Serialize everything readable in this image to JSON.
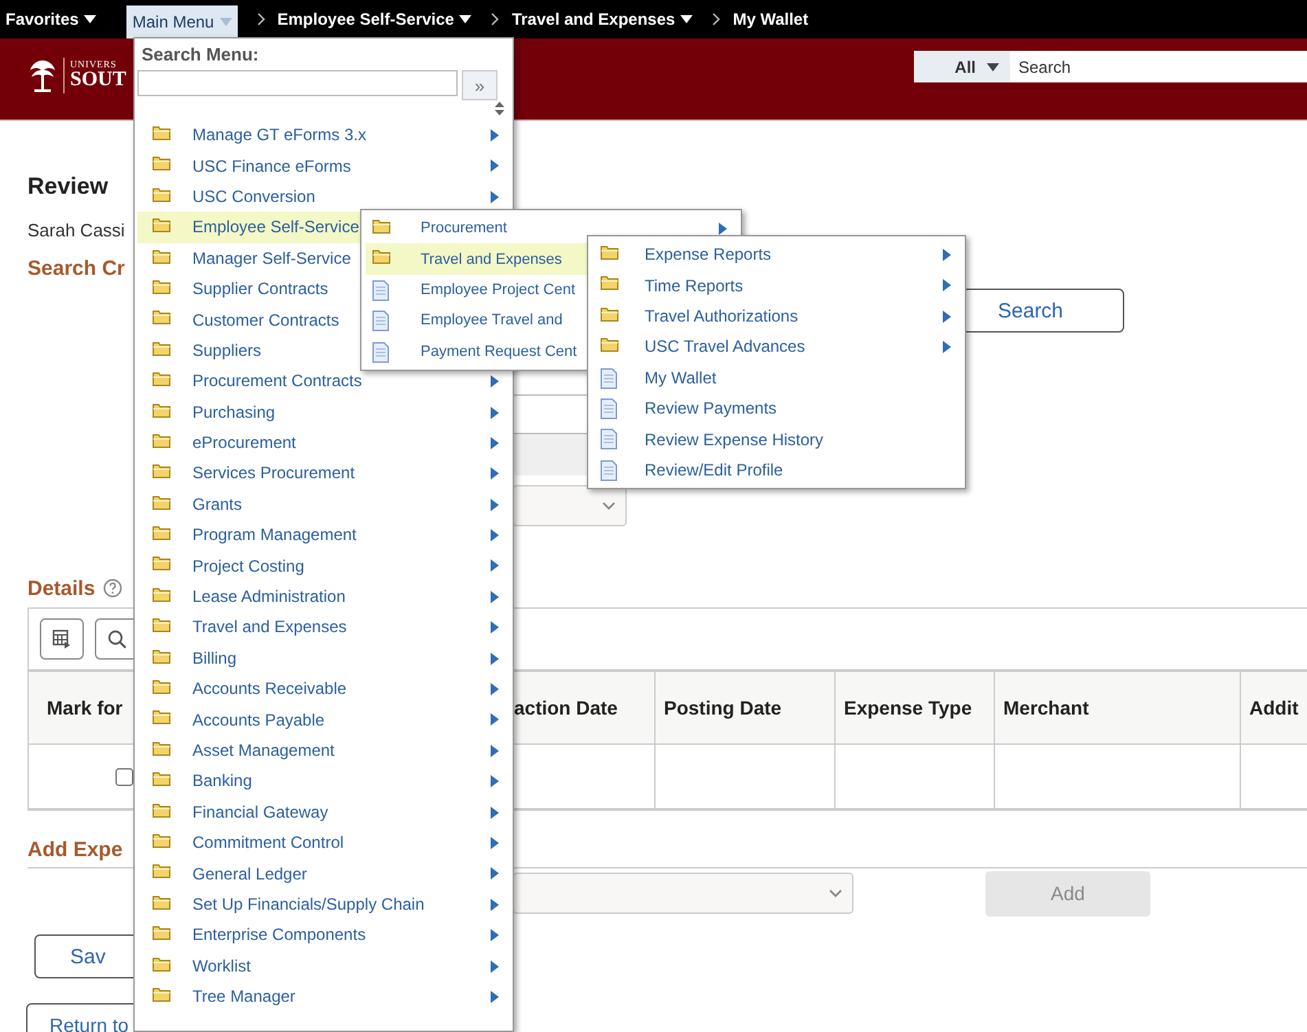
{
  "top_bar": {
    "favorites": "Favorites",
    "main_menu": {
      "label": "Main Menu",
      "selected": true
    },
    "breadcrumbs": [
      {
        "label": "Employee Self-Service",
        "dropdown": true
      },
      {
        "label": "Travel and Expenses",
        "dropdown": true
      },
      {
        "label": "My Wallet",
        "dropdown": false
      }
    ]
  },
  "header": {
    "logo_text": [
      "UNIVERS",
      "SOUT"
    ],
    "search_scope": "All",
    "search_placeholder": "Search"
  },
  "page": {
    "title": "Review",
    "user": "Sarah Cassi",
    "search_heading": "Search Cr",
    "search_button": "Search",
    "details_heading": "Details",
    "table": {
      "columns": [
        "Mark for",
        "action Date",
        "Posting Date",
        "Expense Type",
        "Merchant",
        "Addit"
      ],
      "rows": [
        {
          "checked": false
        }
      ]
    },
    "add_heading": "Add Expe",
    "add_button": {
      "label": "Add",
      "disabled": true
    },
    "save_button": "Sav",
    "return_button": "Return to"
  },
  "main_menu": {
    "title": "Search Menu:",
    "go_button": "»",
    "items": [
      {
        "label": "Manage GT eForms 3.x",
        "kind": "folder",
        "selected": false
      },
      {
        "label": "USC Finance eForms",
        "kind": "folder",
        "selected": false
      },
      {
        "label": "USC Conversion",
        "kind": "folder",
        "selected": false
      },
      {
        "label": "Employee Self-Service",
        "kind": "folder",
        "selected": true
      },
      {
        "label": "Manager Self-Service",
        "kind": "folder",
        "selected": false
      },
      {
        "label": "Supplier Contracts",
        "kind": "folder",
        "selected": false
      },
      {
        "label": "Customer Contracts",
        "kind": "folder",
        "selected": false
      },
      {
        "label": "Suppliers",
        "kind": "folder",
        "selected": false
      },
      {
        "label": "Procurement Contracts",
        "kind": "folder",
        "selected": false
      },
      {
        "label": "Purchasing",
        "kind": "folder",
        "selected": false
      },
      {
        "label": "eProcurement",
        "kind": "folder",
        "selected": false
      },
      {
        "label": "Services Procurement",
        "kind": "folder",
        "selected": false
      },
      {
        "label": "Grants",
        "kind": "folder",
        "selected": false
      },
      {
        "label": "Program Management",
        "kind": "folder",
        "selected": false
      },
      {
        "label": "Project Costing",
        "kind": "folder",
        "selected": false
      },
      {
        "label": "Lease Administration",
        "kind": "folder",
        "selected": false
      },
      {
        "label": "Travel and Expenses",
        "kind": "folder",
        "selected": false
      },
      {
        "label": "Billing",
        "kind": "folder",
        "selected": false
      },
      {
        "label": "Accounts Receivable",
        "kind": "folder",
        "selected": false
      },
      {
        "label": "Accounts Payable",
        "kind": "folder",
        "selected": false
      },
      {
        "label": "Asset Management",
        "kind": "folder",
        "selected": false
      },
      {
        "label": "Banking",
        "kind": "folder",
        "selected": false
      },
      {
        "label": "Financial Gateway",
        "kind": "folder",
        "selected": false
      },
      {
        "label": "Commitment Control",
        "kind": "folder",
        "selected": false
      },
      {
        "label": "General Ledger",
        "kind": "folder",
        "selected": false
      },
      {
        "label": "Set Up Financials/Supply Chain",
        "kind": "folder",
        "selected": false
      },
      {
        "label": "Enterprise Components",
        "kind": "folder",
        "selected": false
      },
      {
        "label": "Worklist",
        "kind": "folder",
        "selected": false
      },
      {
        "label": "Tree Manager",
        "kind": "folder",
        "selected": false
      }
    ]
  },
  "submenus": [
    {
      "items": [
        {
          "label": "Procurement",
          "kind": "folder",
          "selected": false
        },
        {
          "label": "Travel and Expenses",
          "kind": "folder",
          "selected": true
        },
        {
          "label": "Employee Project Cent",
          "kind": "page",
          "selected": false
        },
        {
          "label": "Employee Travel and",
          "kind": "page",
          "selected": false
        },
        {
          "label": "Payment Request Cent",
          "kind": "page",
          "selected": false
        }
      ]
    },
    {
      "items": [
        {
          "label": "Expense Reports",
          "kind": "folder",
          "selected": false
        },
        {
          "label": "Time Reports",
          "kind": "folder",
          "selected": false
        },
        {
          "label": "Travel Authorizations",
          "kind": "folder",
          "selected": false
        },
        {
          "label": "USC Travel Advances",
          "kind": "folder",
          "selected": false
        },
        {
          "label": "My Wallet",
          "kind": "page",
          "selected": false
        },
        {
          "label": "Review Payments",
          "kind": "page",
          "selected": false
        },
        {
          "label": "Review Expense History",
          "kind": "page",
          "selected": false
        },
        {
          "label": "Review/Edit Profile",
          "kind": "page",
          "selected": false
        }
      ]
    }
  ]
}
